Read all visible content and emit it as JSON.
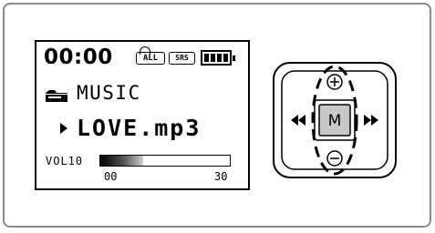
{
  "lcd": {
    "time": "00:00",
    "repeat_badge": "ALL",
    "srs_badge": "SRS",
    "battery_level": 1.0,
    "folder_label": "MUSIC",
    "track_label": "LOVE.mp3",
    "volume_label": "VOL10",
    "volume_min": "00",
    "volume_max": "30",
    "volume_value": 10
  },
  "dpad": {
    "center_label": "M",
    "up_symbol": "⊕",
    "down_symbol": "⊖",
    "left_symbol": "«",
    "right_symbol": "»"
  },
  "icons": {
    "folder": "folder-icon",
    "play": "play-icon",
    "battery": "battery-icon",
    "repeat": "repeat-icon"
  }
}
